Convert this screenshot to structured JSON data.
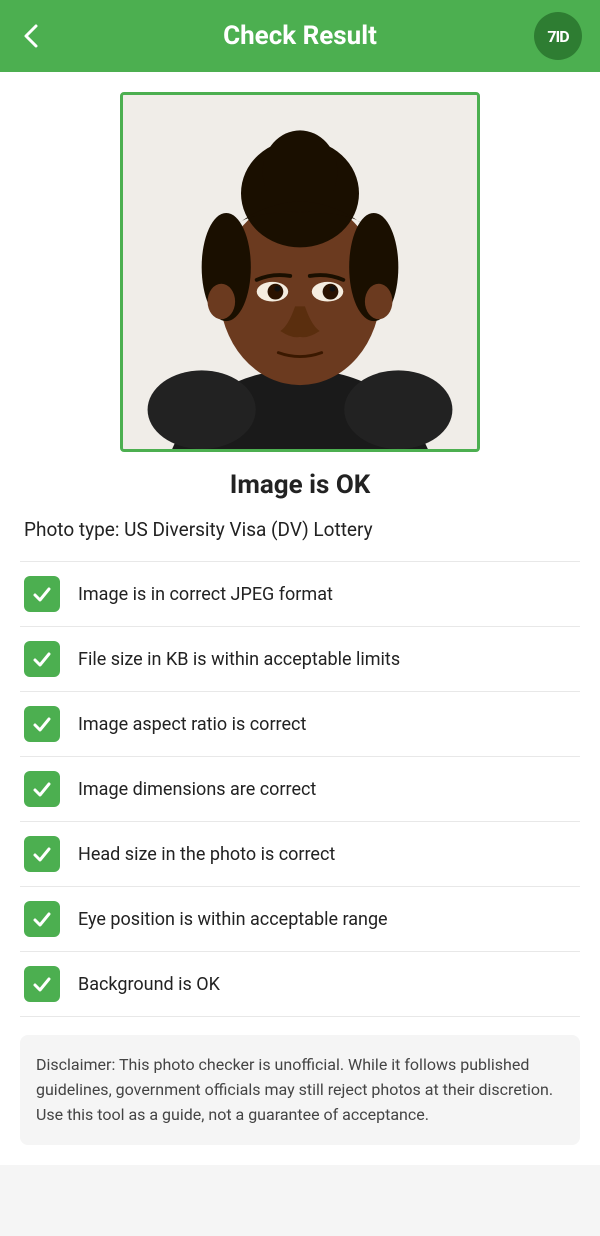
{
  "header": {
    "title": "Check Result",
    "back_icon": "←",
    "logo_text": "7ID",
    "bg_color": "#4caf50"
  },
  "status": {
    "label": "Image is OK"
  },
  "photo_type": {
    "label": "Photo type: US Diversity Visa (DV) Lottery"
  },
  "checks": [
    {
      "label": "Image is in correct JPEG format",
      "passed": true
    },
    {
      "label": "File size in KB is within acceptable limits",
      "passed": true
    },
    {
      "label": "Image aspect ratio is correct",
      "passed": true
    },
    {
      "label": "Image dimensions are correct",
      "passed": true
    },
    {
      "label": "Head size in the photo is correct",
      "passed": true
    },
    {
      "label": "Eye position is within acceptable range",
      "passed": true
    },
    {
      "label": "Background is OK",
      "passed": true
    }
  ],
  "disclaimer": {
    "text": "Disclaimer: This photo checker is unofficial. While it follows published guidelines, government officials may still reject photos at their discretion. Use this tool as a guide, not a guarantee of acceptance."
  }
}
